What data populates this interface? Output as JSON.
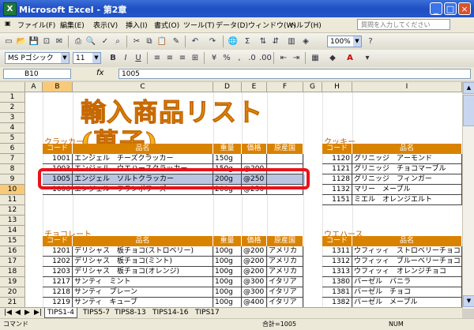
{
  "window": {
    "app_icon": "X",
    "title": "Microsoft Excel - 第2章"
  },
  "menu": [
    "ファイル(F)",
    "編集(E)",
    "表示(V)",
    "挿入(I)",
    "書式(O)",
    "ツール(T)",
    "データ(D)",
    "ウィンドウ(W)",
    "ヘルプ(H)"
  ],
  "help_placeholder": "質問を入力してください",
  "toolbar": {
    "zoom": "100%",
    "font_name": "MS Pゴシック",
    "font_size": "11",
    "bold": "B",
    "italic": "I",
    "underline": "U",
    "sigma": "Σ",
    "currency": "%",
    "font_color": "A"
  },
  "formula_bar": {
    "cell_ref": "B10",
    "fx": "fx",
    "value": "1005"
  },
  "columns": [
    "A",
    "B",
    "C",
    "D",
    "E",
    "F",
    "G",
    "H",
    "I"
  ],
  "rows": [
    "1",
    "2",
    "3",
    "4",
    "5",
    "6",
    "7",
    "8",
    "9",
    "10",
    "11",
    "12",
    "13",
    "14",
    "15",
    "16",
    "17",
    "18",
    "19",
    "20",
    "21",
    "22"
  ],
  "sheet_title": "輸入商品リスト(菓子)",
  "crackers": {
    "label": "クラッカー",
    "headers": [
      "コード",
      "品名",
      "重量",
      "価格",
      "原産国"
    ],
    "rows": [
      [
        "1001",
        "エンジェル　チーズクラッカー",
        "150g",
        "",
        ""
      ],
      [
        "1003",
        "エンジェル　ウエハースクラッカー",
        "150g",
        "@200",
        ""
      ],
      [
        "1005",
        "エンジェル　ソルトクラッカー",
        "200g",
        "@250",
        ""
      ],
      [
        "1006",
        "エンジェル　フランボワーズ",
        "200g",
        "@250",
        ""
      ]
    ]
  },
  "cookies": {
    "label": "クッキー",
    "headers": [
      "コード",
      "品名"
    ],
    "rows": [
      [
        "1120",
        "グリニッジ　アーモンド"
      ],
      [
        "1121",
        "グリニッジ　チョコマーブル"
      ],
      [
        "1128",
        "グリニッジ　フィンガー"
      ],
      [
        "1132",
        "マリー　メープル"
      ],
      [
        "1151",
        "ミエル　オレンジエルト"
      ]
    ]
  },
  "chocolate": {
    "label": "チョコレート",
    "headers": [
      "コード",
      "品名",
      "重量",
      "価格",
      "原産国"
    ],
    "rows": [
      [
        "1201",
        "デリシャス　板チョコ(ストロベリー)",
        "100g",
        "@200",
        "アメリカ"
      ],
      [
        "1202",
        "デリシャス　板チョコ(ミント)",
        "100g",
        "@200",
        "アメリカ"
      ],
      [
        "1203",
        "デリシャス　板チョコ(オレンジ)",
        "100g",
        "@200",
        "アメリカ"
      ],
      [
        "1217",
        "サンティ　ミント",
        "100g",
        "@300",
        "イタリア"
      ],
      [
        "1218",
        "サンティ　プレーン",
        "100g",
        "@300",
        "イタリア"
      ],
      [
        "1219",
        "サンティ　キューブ",
        "100g",
        "@400",
        "イタリア"
      ]
    ]
  },
  "wafers": {
    "label": "ウエハース",
    "headers": [
      "コード",
      "品名"
    ],
    "rows": [
      [
        "1311",
        "ウフィッィ　ストロベリーチョコ"
      ],
      [
        "1312",
        "ウフィッィ　ブルーベリーチョコ"
      ],
      [
        "1313",
        "ウフィッィ　オレンジチョコ"
      ],
      [
        "1380",
        "バーゼル　バニラ"
      ],
      [
        "1381",
        "バーゼル　チョコ"
      ],
      [
        "1382",
        "バーゼル　メープル"
      ]
    ]
  },
  "sheet_tabs": [
    "TIPS1-4",
    "TIPS5-7",
    "TIPS8-13",
    "TIPS14-16",
    "TIPS17"
  ],
  "status": {
    "mode": "コマンド",
    "sum": "合計=1005",
    "num": "NUM"
  }
}
